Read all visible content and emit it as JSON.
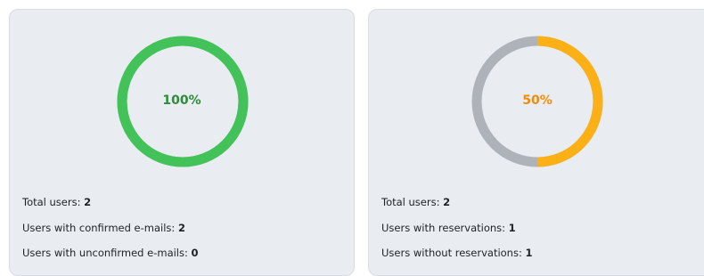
{
  "left_card": {
    "percent_label": "100%",
    "percent_value": 1.0,
    "colors": {
      "progress": "#44c25a",
      "track": "#44c25a",
      "text": "#2e8b3c"
    },
    "stats": [
      {
        "label": "Total users: ",
        "value": "2"
      },
      {
        "label": "Users with confirmed e-mails: ",
        "value": "2"
      },
      {
        "label": "Users with unconfirmed e-mails: ",
        "value": "0"
      }
    ]
  },
  "right_card": {
    "percent_label": "50%",
    "percent_value": 0.5,
    "colors": {
      "progress": "#fbb116",
      "track": "#adb3b9",
      "text": "#f08c0c"
    },
    "stats": [
      {
        "label": "Total users: ",
        "value": "2"
      },
      {
        "label": "Users with reservations: ",
        "value": "1"
      },
      {
        "label": "Users without reservations: ",
        "value": "1"
      }
    ]
  }
}
